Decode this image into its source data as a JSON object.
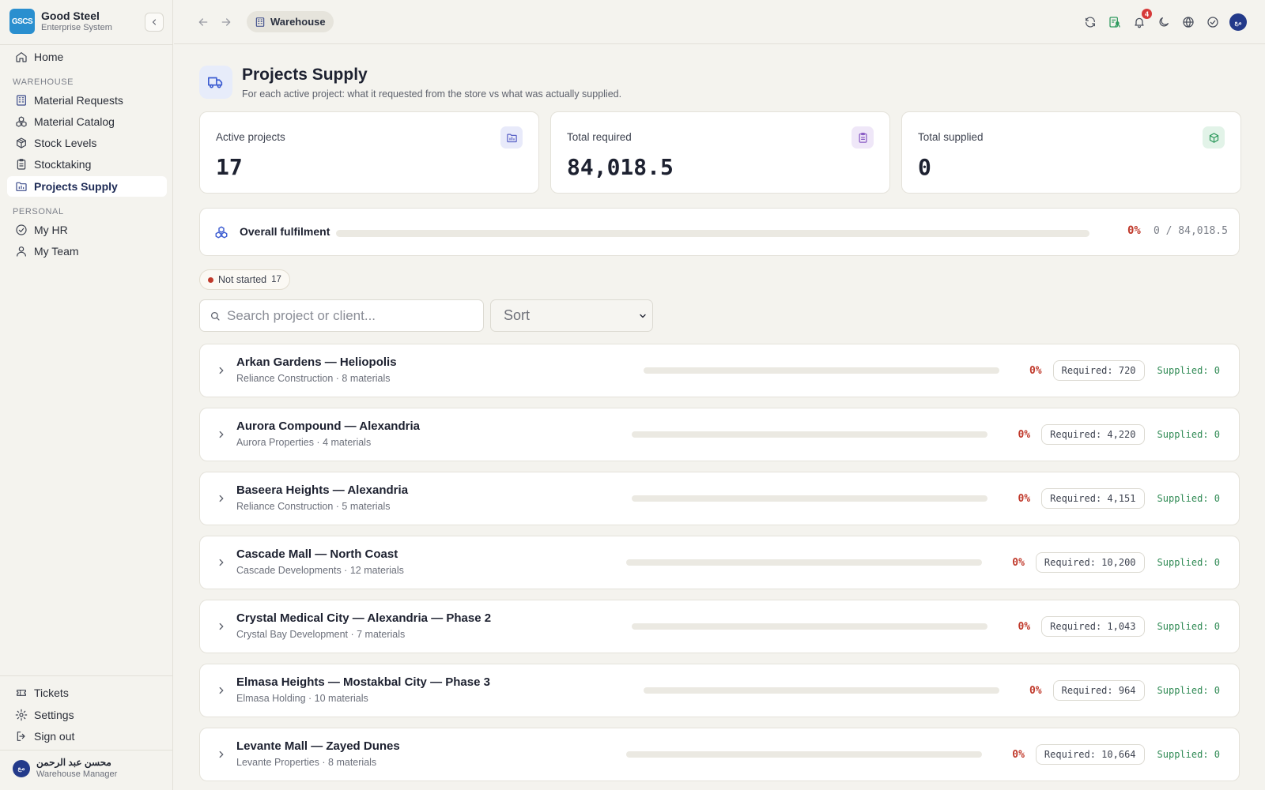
{
  "brand": {
    "logo_text": "GSCS",
    "name": "Good Steel",
    "subtitle": "Enterprise System"
  },
  "sidebar": {
    "home": "Home",
    "warehouse_section": "WAREHOUSE",
    "warehouse_items": [
      {
        "label": "Material Requests",
        "icon": "building-icon",
        "active": false
      },
      {
        "label": "Material Catalog",
        "icon": "boxes-icon",
        "active": false
      },
      {
        "label": "Stock Levels",
        "icon": "package-icon",
        "active": false
      },
      {
        "label": "Stocktaking",
        "icon": "clipboard-icon",
        "active": false
      },
      {
        "label": "Projects Supply",
        "icon": "folder-chart-icon",
        "active": true
      }
    ],
    "personal_section": "PERSONAL",
    "personal_items": [
      {
        "label": "My HR",
        "icon": "check-circle-icon"
      },
      {
        "label": "My Team",
        "icon": "user-icon"
      }
    ],
    "bottom_items": [
      {
        "label": "Tickets",
        "icon": "ticket-icon"
      },
      {
        "label": "Settings",
        "icon": "gear-icon"
      },
      {
        "label": "Sign out",
        "icon": "sign-out-icon"
      }
    ],
    "user": {
      "initials": "مع",
      "name": "محسن عبد الرحمن",
      "role": "Warehouse Manager"
    }
  },
  "topbar": {
    "breadcrumb": "Warehouse",
    "notification_count": "4",
    "avatar_initials": "مع"
  },
  "page": {
    "title": "Projects Supply",
    "subtitle": "For each active project: what it requested from the store vs what was actually supplied."
  },
  "stats": [
    {
      "label": "Active projects",
      "value": "17",
      "accent": "#5b63c7"
    },
    {
      "label": "Total required",
      "value": "84,018.5",
      "accent": "#8a5cc4"
    },
    {
      "label": "Total supplied",
      "value": "0",
      "accent": "#2f9a5e"
    }
  ],
  "overall": {
    "label": "Overall fulfilment",
    "fraction": 0,
    "percent": "0%",
    "ratio": "0 / 84,018.5"
  },
  "filter": {
    "label": "Not started",
    "count": "17"
  },
  "search": {
    "placeholder": "Search project or client..."
  },
  "sort": {
    "label": "Sort"
  },
  "colors": {
    "danger": "#c0392b",
    "success": "#2f9a5e",
    "accent": "#233a8a"
  },
  "projects": [
    {
      "name": "Arkan Gardens — Heliopolis",
      "meta": "Reliance Construction · 8 materials",
      "fraction": 0,
      "percent": "0%",
      "required": "Required: 720",
      "supplied": "Supplied: 0"
    },
    {
      "name": "Aurora Compound — Alexandria",
      "meta": "Aurora Properties · 4 materials",
      "fraction": 0,
      "percent": "0%",
      "required": "Required: 4,220",
      "supplied": "Supplied: 0"
    },
    {
      "name": "Baseera Heights — Alexandria",
      "meta": "Reliance Construction · 5 materials",
      "fraction": 0,
      "percent": "0%",
      "required": "Required: 4,151",
      "supplied": "Supplied: 0"
    },
    {
      "name": "Cascade Mall — North Coast",
      "meta": "Cascade Developments · 12 materials",
      "fraction": 0,
      "percent": "0%",
      "required": "Required: 10,200",
      "supplied": "Supplied: 0"
    },
    {
      "name": "Crystal Medical City — Alexandria — Phase 2",
      "meta": "Crystal Bay Development · 7 materials",
      "fraction": 0,
      "percent": "0%",
      "required": "Required: 1,043",
      "supplied": "Supplied: 0"
    },
    {
      "name": "Elmasa Heights — Mostakbal City — Phase 3",
      "meta": "Elmasa Holding · 10 materials",
      "fraction": 0,
      "percent": "0%",
      "required": "Required: 964",
      "supplied": "Supplied: 0"
    },
    {
      "name": "Levante Mall — Zayed Dunes",
      "meta": "Levante Properties · 8 materials",
      "fraction": 0,
      "percent": "0%",
      "required": "Required: 10,664",
      "supplied": "Supplied: 0"
    }
  ]
}
